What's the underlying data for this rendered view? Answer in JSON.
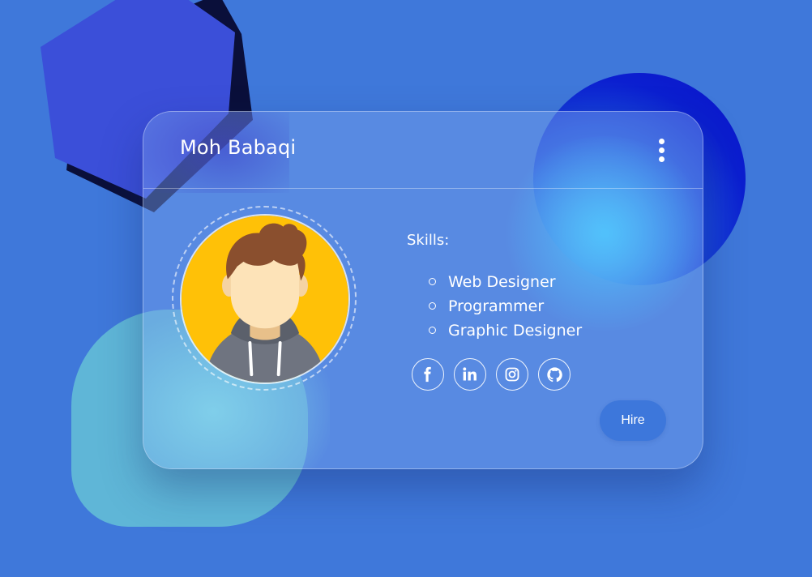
{
  "background": {
    "color": "#3f78da",
    "shapes": [
      "hexagon",
      "circle",
      "rounded-square"
    ]
  },
  "card": {
    "title": "Moh Babaqi",
    "menu_icon": "kebab-menu-icon",
    "avatar_icon": "user-avatar-illustration",
    "skills_label": "Skills:",
    "skills": [
      "Web Designer",
      "Programmer",
      "Graphic Designer"
    ],
    "socials": [
      {
        "name": "facebook",
        "icon": "facebook-icon"
      },
      {
        "name": "linkedin",
        "icon": "linkedin-icon"
      },
      {
        "name": "instagram",
        "icon": "instagram-icon"
      },
      {
        "name": "github",
        "icon": "github-icon"
      }
    ],
    "hire_label": "Hire"
  },
  "colors": {
    "accent": "#3d77db",
    "avatar_bg": "#ffc107",
    "hair": "#8a4f2e",
    "hoodie": "#6f7480"
  }
}
